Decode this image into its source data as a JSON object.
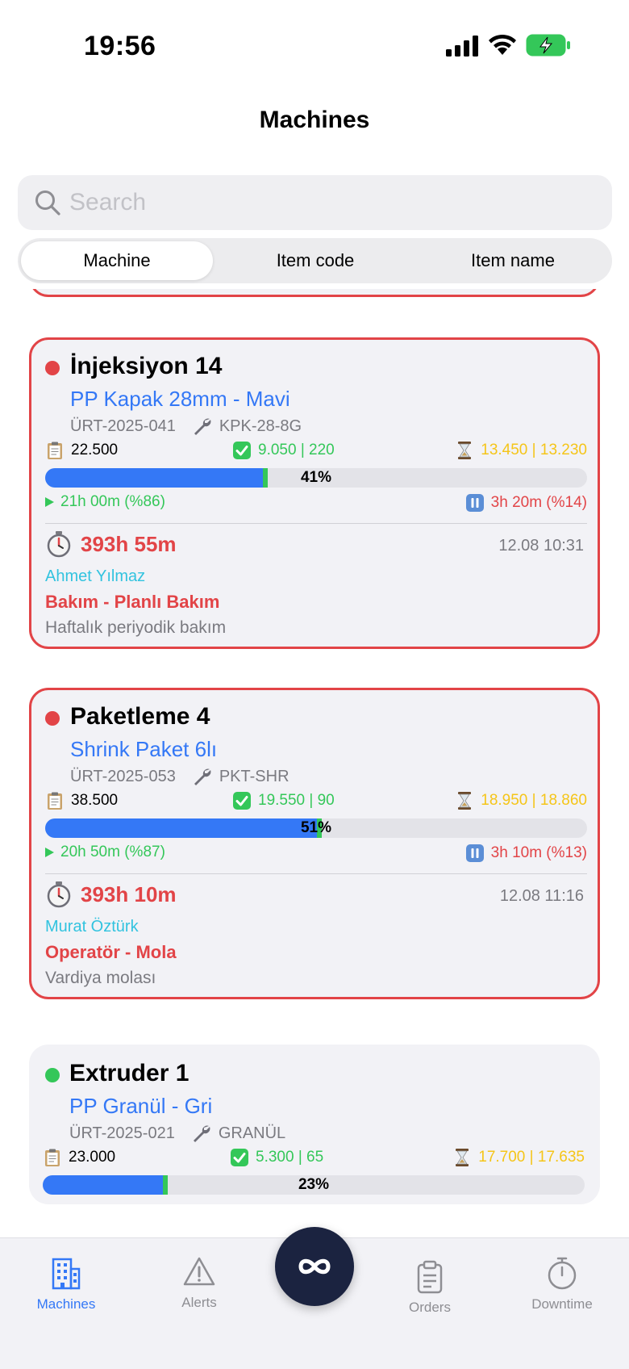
{
  "status_bar": {
    "time": "19:56"
  },
  "header": {
    "title": "Machines"
  },
  "search": {
    "placeholder": "Search"
  },
  "segments": [
    {
      "label": "Machine",
      "selected": true
    },
    {
      "label": "Item code",
      "selected": false
    },
    {
      "label": "Item name",
      "selected": false
    }
  ],
  "colors": {
    "accent": "#3478f6",
    "alert": "#e24447",
    "ok": "#34c759",
    "remaining": "#f5c518",
    "operator": "#32c3df"
  },
  "machines": [
    {
      "status": "stopped",
      "status_color": "#e24447",
      "name": "İnjeksiyon 14",
      "item_name": "PP Kapak 28mm - Mavi",
      "order_code": "ÜRT-2025-041",
      "item_code": "KPK-28-8G",
      "planned": "22.500",
      "produced": "9.050 | 220",
      "remaining": "13.450 | 13.230",
      "progress_percent": 41,
      "progress_label": "41%",
      "run_time": "21h 00m (%86)",
      "stop_time": "3h 20m (%14)",
      "downtime": {
        "duration": "393h 55m",
        "start": "12.08 10:31",
        "operator": "Ahmet Yılmaz",
        "reason": "Bakım - Planlı Bakım",
        "note": "Haftalık periyodik bakım"
      }
    },
    {
      "status": "stopped",
      "status_color": "#e24447",
      "name": "Paketleme 4",
      "item_name": "Shrink Paket 6lı",
      "order_code": "ÜRT-2025-053",
      "item_code": "PKT-SHR",
      "planned": "38.500",
      "produced": "19.550 | 90",
      "remaining": "18.950 | 18.860",
      "progress_percent": 51,
      "progress_label": "51%",
      "run_time": "20h 50m (%87)",
      "stop_time": "3h 10m (%13)",
      "downtime": {
        "duration": "393h 10m",
        "start": "12.08 11:16",
        "operator": "Murat Öztürk",
        "reason": "Operatör - Mola",
        "note": "Vardiya molası"
      }
    },
    {
      "status": "running",
      "status_color": "#34c759",
      "name": "Extruder 1",
      "item_name": "PP Granül - Gri",
      "order_code": "ÜRT-2025-021",
      "item_code": "GRANÜL",
      "planned": "23.000",
      "produced": "5.300 | 65",
      "remaining": "17.700 | 17.635",
      "progress_percent": 23,
      "progress_label": "23%"
    }
  ],
  "tabs": [
    {
      "label": "Machines",
      "icon": "building-icon",
      "active": true
    },
    {
      "label": "Alerts",
      "icon": "warning-icon",
      "active": false
    },
    {
      "label": "Orders",
      "icon": "clipboard-icon",
      "active": false
    },
    {
      "label": "Downtime",
      "icon": "stopwatch-icon",
      "active": false
    }
  ],
  "fab": {
    "icon": "infinity-icon"
  }
}
